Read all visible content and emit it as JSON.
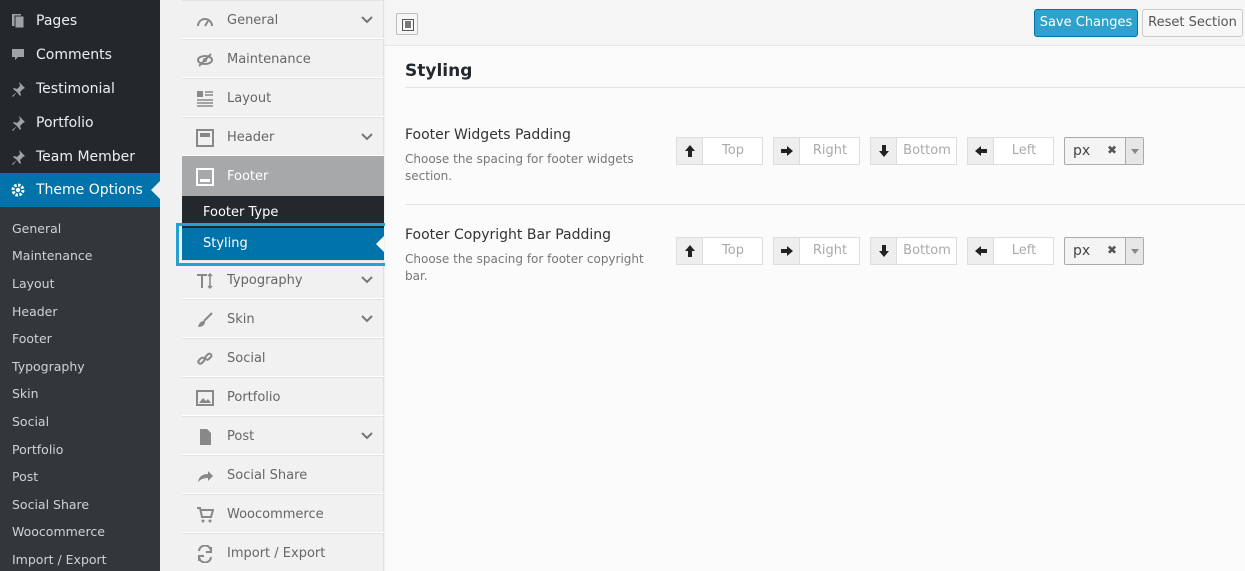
{
  "wp_menu": {
    "items": [
      {
        "label": "Pages",
        "icon": "pages-icon"
      },
      {
        "label": "Comments",
        "icon": "comments-icon"
      },
      {
        "label": "Testimonial",
        "icon": "pin-icon"
      },
      {
        "label": "Portfolio",
        "icon": "pin-icon"
      },
      {
        "label": "Team Member",
        "icon": "pin-icon"
      },
      {
        "label": "Theme Options",
        "icon": "gear-icon",
        "active": true
      }
    ],
    "submenu": [
      "General",
      "Maintenance",
      "Layout",
      "Header",
      "Footer",
      "Typography",
      "Skin",
      "Social",
      "Portfolio",
      "Post",
      "Social Share",
      "Woocommerce",
      "Import / Export"
    ]
  },
  "options_menu": {
    "items": [
      {
        "label": "General",
        "icon": "dashboard-icon",
        "has_children": true
      },
      {
        "label": "Maintenance",
        "icon": "hidden-eye-icon",
        "has_children": false
      },
      {
        "label": "Layout",
        "icon": "layout-icon",
        "has_children": false
      },
      {
        "label": "Header",
        "icon": "header-icon",
        "has_children": true
      },
      {
        "label": "Footer",
        "icon": "footer-icon",
        "has_children": false,
        "active": true
      },
      {
        "label": "Typography",
        "icon": "typography-icon",
        "has_children": true
      },
      {
        "label": "Skin",
        "icon": "brush-icon",
        "has_children": true
      },
      {
        "label": "Social",
        "icon": "link-icon",
        "has_children": false
      },
      {
        "label": "Portfolio",
        "icon": "image-icon",
        "has_children": false
      },
      {
        "label": "Post",
        "icon": "document-icon",
        "has_children": true
      },
      {
        "label": "Social Share",
        "icon": "share-icon",
        "has_children": false
      },
      {
        "label": "Woocommerce",
        "icon": "cart-icon",
        "has_children": false
      },
      {
        "label": "Import / Export",
        "icon": "refresh-icon",
        "has_children": false
      }
    ],
    "footer_sub": {
      "type": "Footer Type",
      "styling": "Styling"
    }
  },
  "toolbar": {
    "save_label": "Save Changes",
    "reset_label": "Reset Section"
  },
  "section": {
    "title": "Styling",
    "fields": [
      {
        "title": "Footer Widgets Padding",
        "description": "Choose the spacing for footer widgets section.",
        "placeholders": {
          "top": "Top",
          "right": "Right",
          "bottom": "Bottom",
          "left": "Left"
        },
        "unit": "px"
      },
      {
        "title": "Footer Copyright Bar Padding",
        "description": "Choose the spacing for footer copyright bar.",
        "placeholders": {
          "top": "Top",
          "right": "Right",
          "bottom": "Bottom",
          "left": "Left"
        },
        "unit": "px"
      }
    ]
  },
  "colors": {
    "wp_sidebar_bg": "#23282d",
    "accent_blue": "#0073aa",
    "highlight_border": "#1fa3d5",
    "save_button": "#2ea2cc"
  }
}
